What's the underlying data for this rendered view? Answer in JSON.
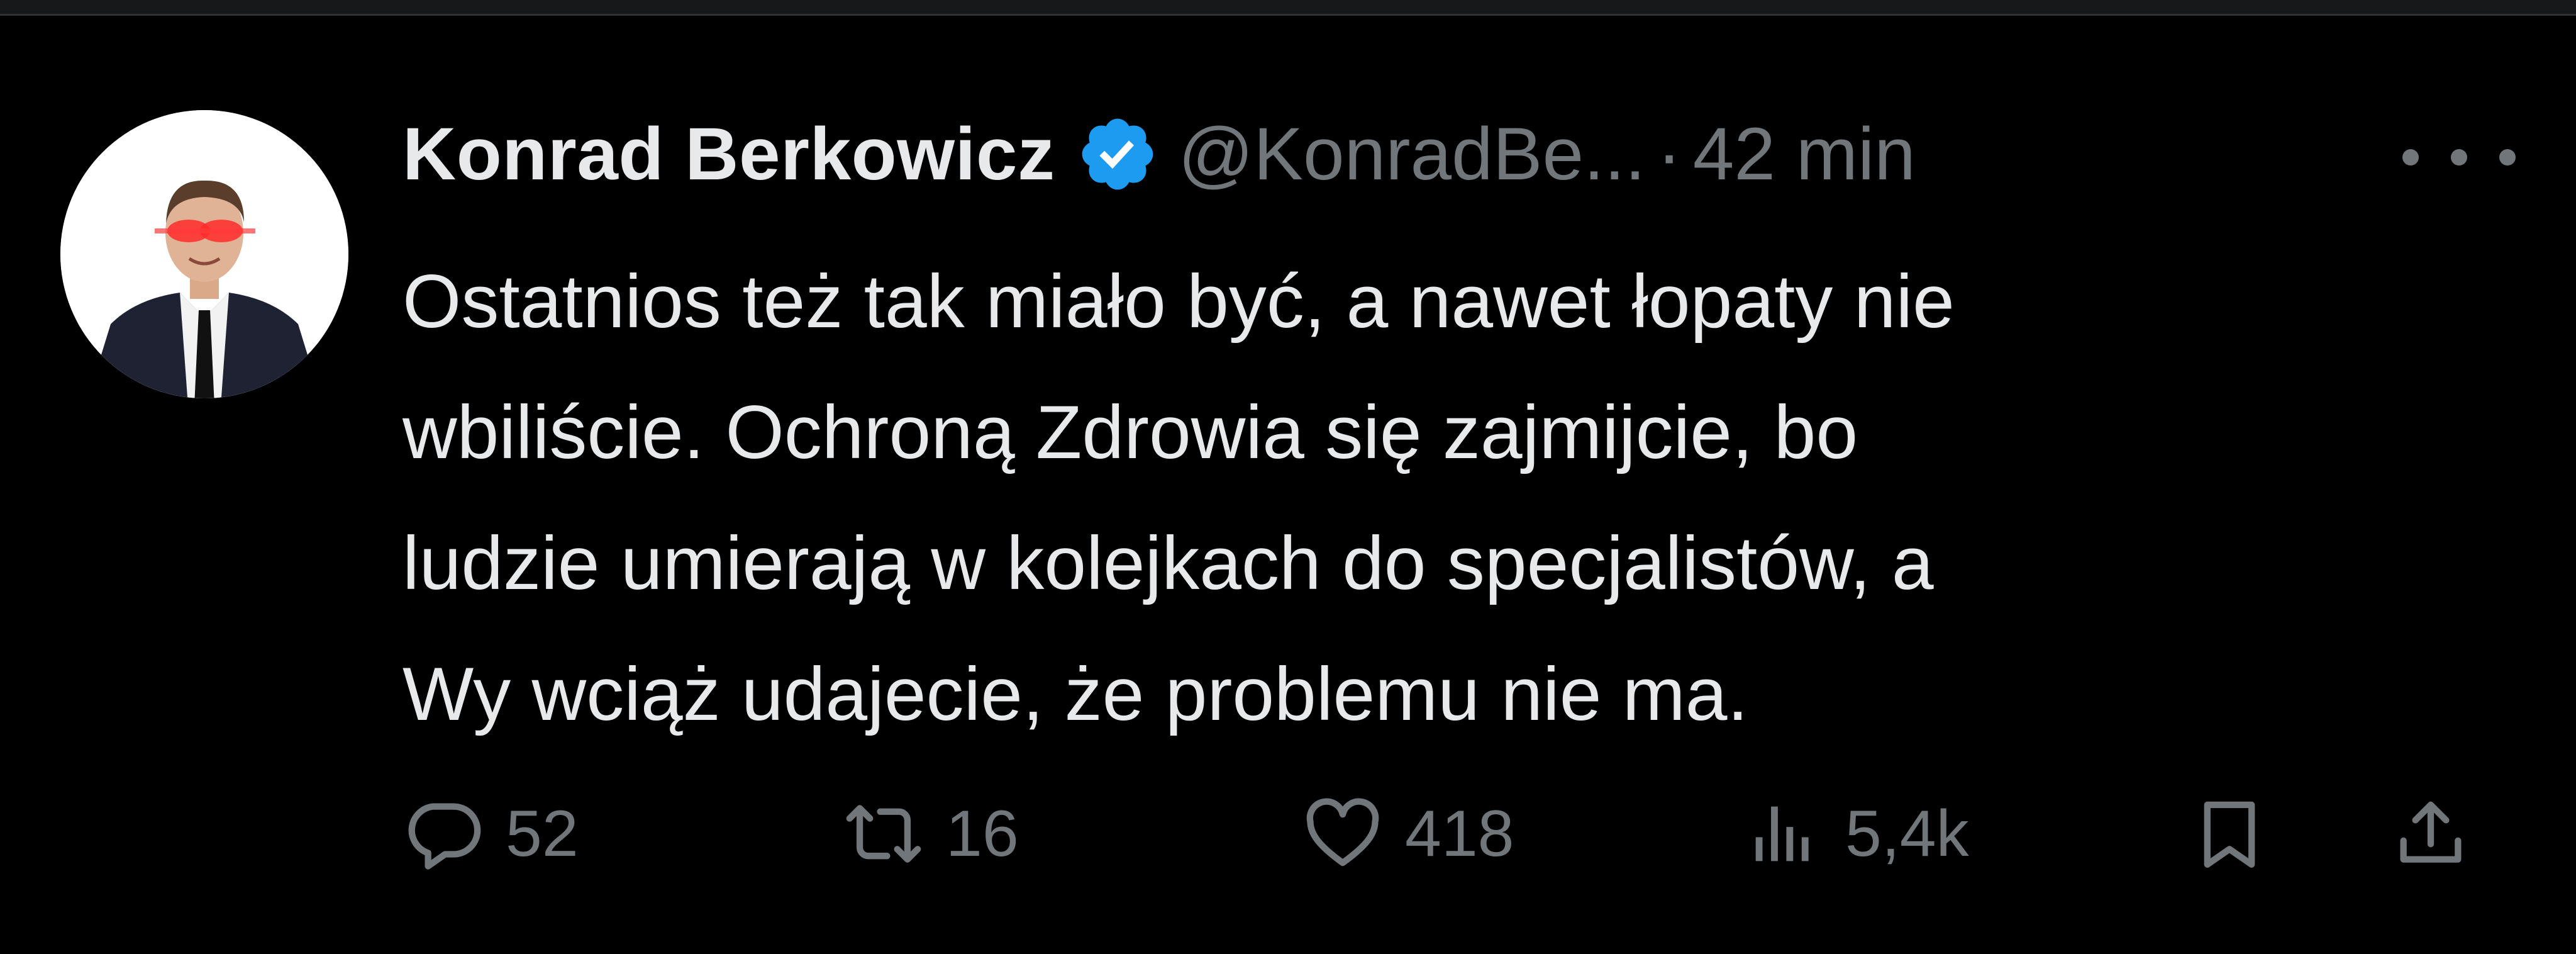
{
  "tweet": {
    "author": {
      "display_name": "Konrad Berkowicz",
      "verified_icon": "verified-badge-icon",
      "handle": "@KonradBe...",
      "separator": "·",
      "time": "42 min"
    },
    "text": "Ostatnios też tak miało być, a nawet łopaty nie\nwbiliście. Ochroną Zdrowia się zajmijcie, bo\nludzie umierają w kolejkach do specjalistów, a\nWy wciąż udajecie, że problemu nie ma.",
    "actions": {
      "reply": {
        "icon": "reply-icon",
        "count": "52"
      },
      "repost": {
        "icon": "repost-icon",
        "count": "16"
      },
      "like": {
        "icon": "heart-icon",
        "count": "418"
      },
      "views": {
        "icon": "views-chart-icon",
        "count": "5,4k"
      },
      "bookmark": {
        "icon": "bookmark-icon"
      },
      "share": {
        "icon": "share-icon"
      }
    }
  },
  "colors": {
    "background": "#000000",
    "text_primary": "#e7e9ea",
    "text_secondary": "#71767b",
    "verified_blue": "#1d9bf0",
    "divider": "#2f3336"
  }
}
